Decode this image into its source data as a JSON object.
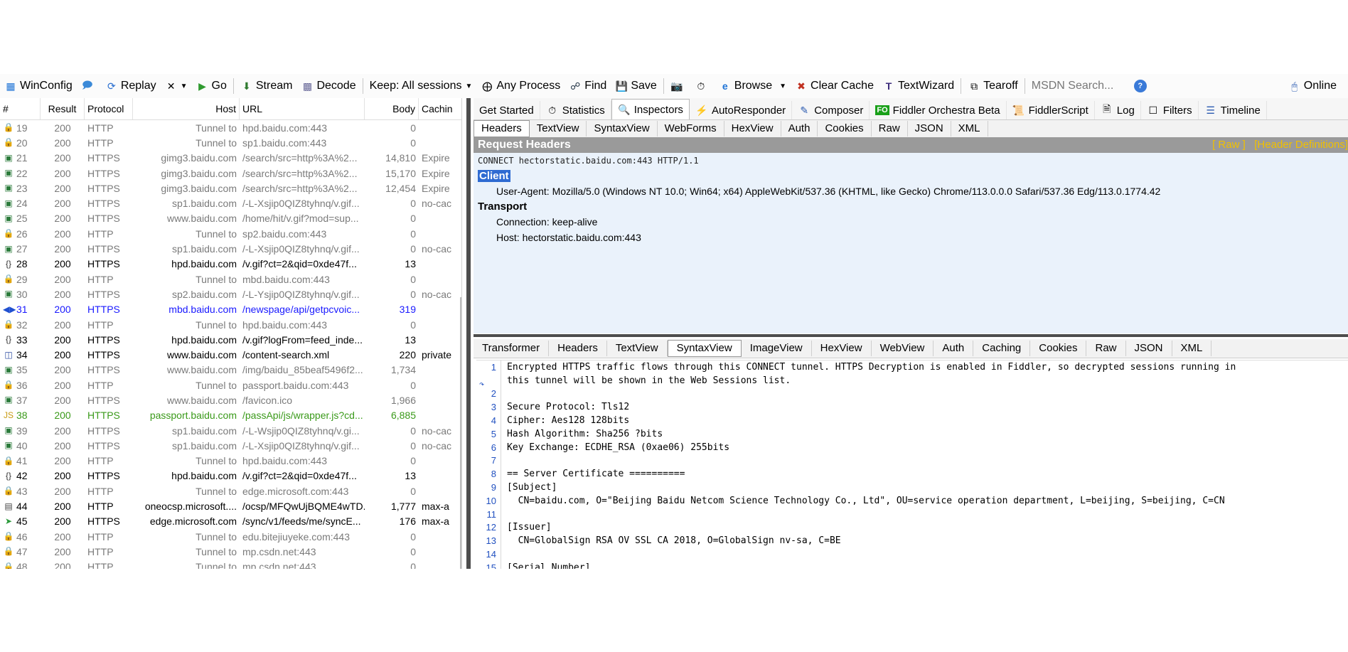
{
  "toolbar": {
    "winconfig": "WinConfig",
    "replay": "Replay",
    "go": "Go",
    "stream": "Stream",
    "decode": "Decode",
    "keep": "Keep: All sessions",
    "any_process": "Any Process",
    "find": "Find",
    "save": "Save",
    "browse": "Browse",
    "clear_cache": "Clear Cache",
    "textwizard": "TextWizard",
    "tearoff": "Tearoff",
    "msdn_search": "MSDN Search...",
    "online": "Online"
  },
  "session_columns": [
    "#",
    "Result",
    "Protocol",
    "Host",
    "URL",
    "Body",
    "Cachin"
  ],
  "sessions": [
    {
      "num": "19",
      "result": "200",
      "protocol": "HTTP",
      "host": "Tunnel to",
      "url": "hpd.baidu.com:443",
      "body": "0",
      "cache": "",
      "style": "tunnel",
      "icon": "lock-icon"
    },
    {
      "num": "20",
      "result": "200",
      "protocol": "HTTP",
      "host": "Tunnel to",
      "url": "sp1.baidu.com:443",
      "body": "0",
      "cache": "",
      "style": "tunnel",
      "icon": "lock-icon"
    },
    {
      "num": "21",
      "result": "200",
      "protocol": "HTTPS",
      "host": "gimg3.baidu.com",
      "url": "/search/src=http%3A%2...",
      "body": "14,810",
      "cache": "Expire",
      "style": "tunnel",
      "icon": "image-icon"
    },
    {
      "num": "22",
      "result": "200",
      "protocol": "HTTPS",
      "host": "gimg3.baidu.com",
      "url": "/search/src=http%3A%2...",
      "body": "15,170",
      "cache": "Expire",
      "style": "tunnel",
      "icon": "image-icon"
    },
    {
      "num": "23",
      "result": "200",
      "protocol": "HTTPS",
      "host": "gimg3.baidu.com",
      "url": "/search/src=http%3A%2...",
      "body": "12,454",
      "cache": "Expire",
      "style": "tunnel",
      "icon": "image-icon"
    },
    {
      "num": "24",
      "result": "200",
      "protocol": "HTTPS",
      "host": "sp1.baidu.com",
      "url": "/-L-Xsjip0QIZ8tyhnq/v.gif...",
      "body": "0",
      "cache": "no-cac",
      "style": "tunnel",
      "icon": "image-icon"
    },
    {
      "num": "25",
      "result": "200",
      "protocol": "HTTPS",
      "host": "www.baidu.com",
      "url": "/home/hit/v.gif?mod=sup...",
      "body": "0",
      "cache": "",
      "style": "tunnel",
      "icon": "image-icon"
    },
    {
      "num": "26",
      "result": "200",
      "protocol": "HTTP",
      "host": "Tunnel to",
      "url": "sp2.baidu.com:443",
      "body": "0",
      "cache": "",
      "style": "tunnel",
      "icon": "lock-icon"
    },
    {
      "num": "27",
      "result": "200",
      "protocol": "HTTPS",
      "host": "sp1.baidu.com",
      "url": "/-L-Xsjip0QIZ8tyhnq/v.gif...",
      "body": "0",
      "cache": "no-cac",
      "style": "tunnel",
      "icon": "image-icon"
    },
    {
      "num": "28",
      "result": "200",
      "protocol": "HTTPS",
      "host": "hpd.baidu.com",
      "url": "/v.gif?ct=2&qid=0xde47f...",
      "body": "13",
      "cache": "",
      "style": "normal",
      "icon": "json-icon"
    },
    {
      "num": "29",
      "result": "200",
      "protocol": "HTTP",
      "host": "Tunnel to",
      "url": "mbd.baidu.com:443",
      "body": "0",
      "cache": "",
      "style": "tunnel",
      "icon": "lock-icon"
    },
    {
      "num": "30",
      "result": "200",
      "protocol": "HTTPS",
      "host": "sp2.baidu.com",
      "url": "/-L-Ysjip0QIZ8tyhnq/v.gif...",
      "body": "0",
      "cache": "no-cac",
      "style": "tunnel",
      "icon": "image-icon"
    },
    {
      "num": "31",
      "result": "200",
      "protocol": "HTTPS",
      "host": "mbd.baidu.com",
      "url": "/newspage/api/getpcvoic...",
      "body": "319",
      "cache": "",
      "style": "blue",
      "icon": "arrows-icon"
    },
    {
      "num": "32",
      "result": "200",
      "protocol": "HTTP",
      "host": "Tunnel to",
      "url": "hpd.baidu.com:443",
      "body": "0",
      "cache": "",
      "style": "tunnel",
      "icon": "lock-icon"
    },
    {
      "num": "33",
      "result": "200",
      "protocol": "HTTPS",
      "host": "hpd.baidu.com",
      "url": "/v.gif?logFrom=feed_inde...",
      "body": "13",
      "cache": "",
      "style": "normal",
      "icon": "json-icon"
    },
    {
      "num": "34",
      "result": "200",
      "protocol": "HTTPS",
      "host": "www.baidu.com",
      "url": "/content-search.xml",
      "body": "220",
      "cache": "private",
      "style": "normal",
      "icon": "xml-icon"
    },
    {
      "num": "35",
      "result": "200",
      "protocol": "HTTPS",
      "host": "www.baidu.com",
      "url": "/img/baidu_85beaf5496f2...",
      "body": "1,734",
      "cache": "",
      "style": "tunnel",
      "icon": "image-icon"
    },
    {
      "num": "36",
      "result": "200",
      "protocol": "HTTP",
      "host": "Tunnel to",
      "url": "passport.baidu.com:443",
      "body": "0",
      "cache": "",
      "style": "tunnel",
      "icon": "lock-icon"
    },
    {
      "num": "37",
      "result": "200",
      "protocol": "HTTPS",
      "host": "www.baidu.com",
      "url": "/favicon.ico",
      "body": "1,966",
      "cache": "",
      "style": "tunnel",
      "icon": "image-icon"
    },
    {
      "num": "38",
      "result": "200",
      "protocol": "HTTPS",
      "host": "passport.baidu.com",
      "url": "/passApi/js/wrapper.js?cd...",
      "body": "6,885",
      "cache": "",
      "style": "green",
      "icon": "js-icon"
    },
    {
      "num": "39",
      "result": "200",
      "protocol": "HTTPS",
      "host": "sp1.baidu.com",
      "url": "/-L-Wsjip0QIZ8tyhnq/v.gi...",
      "body": "0",
      "cache": "no-cac",
      "style": "tunnel",
      "icon": "image-icon"
    },
    {
      "num": "40",
      "result": "200",
      "protocol": "HTTPS",
      "host": "sp1.baidu.com",
      "url": "/-L-Xsjip0QIZ8tyhnq/v.gif...",
      "body": "0",
      "cache": "no-cac",
      "style": "tunnel",
      "icon": "image-icon"
    },
    {
      "num": "41",
      "result": "200",
      "protocol": "HTTP",
      "host": "Tunnel to",
      "url": "hpd.baidu.com:443",
      "body": "0",
      "cache": "",
      "style": "tunnel",
      "icon": "lock-icon"
    },
    {
      "num": "42",
      "result": "200",
      "protocol": "HTTPS",
      "host": "hpd.baidu.com",
      "url": "/v.gif?ct=2&qid=0xde47f...",
      "body": "13",
      "cache": "",
      "style": "normal",
      "icon": "json-icon"
    },
    {
      "num": "43",
      "result": "200",
      "protocol": "HTTP",
      "host": "Tunnel to",
      "url": "edge.microsoft.com:443",
      "body": "0",
      "cache": "",
      "style": "tunnel",
      "icon": "lock-icon"
    },
    {
      "num": "44",
      "result": "200",
      "protocol": "HTTP",
      "host": "oneocsp.microsoft....",
      "url": "/ocsp/MFQwUjBQME4wTD...",
      "body": "1,777",
      "cache": "max-a",
      "style": "normal",
      "icon": "doc-icon"
    },
    {
      "num": "45",
      "result": "200",
      "protocol": "HTTPS",
      "host": "edge.microsoft.com",
      "url": "/sync/v1/feeds/me/syncE...",
      "body": "176",
      "cache": "max-a",
      "style": "normal",
      "icon": "post-icon"
    },
    {
      "num": "46",
      "result": "200",
      "protocol": "HTTP",
      "host": "Tunnel to",
      "url": "edu.bitejiuyeke.com:443",
      "body": "0",
      "cache": "",
      "style": "tunnel",
      "icon": "lock-icon"
    },
    {
      "num": "47",
      "result": "200",
      "protocol": "HTTP",
      "host": "Tunnel to",
      "url": "mp.csdn.net:443",
      "body": "0",
      "cache": "",
      "style": "tunnel",
      "icon": "lock-icon"
    },
    {
      "num": "48",
      "result": "200",
      "protocol": "HTTP",
      "host": "Tunnel to",
      "url": "mp.csdn.net:443",
      "body": "0",
      "cache": "",
      "style": "tunnel",
      "icon": "lock-icon"
    }
  ],
  "main_tabs": [
    "Get Started",
    "Statistics",
    "Inspectors",
    "AutoResponder",
    "Composer",
    "Fiddler Orchestra Beta",
    "FiddlerScript",
    "Log",
    "Filters",
    "Timeline"
  ],
  "fo_badge": "FO",
  "request_tabs": [
    "Headers",
    "TextView",
    "SyntaxView",
    "WebForms",
    "HexView",
    "Auth",
    "Cookies",
    "Raw",
    "JSON",
    "XML"
  ],
  "request": {
    "title": "Request Headers",
    "raw_link": "[ Raw ]",
    "defs_link": "[Header Definitions]",
    "line": "CONNECT hectorstatic.baidu.com:443 HTTP/1.1",
    "client_label": "Client",
    "user_agent": "User-Agent: Mozilla/5.0 (Windows NT 10.0; Win64; x64) AppleWebKit/537.36 (KHTML, like Gecko) Chrome/113.0.0.0 Safari/537.36 Edg/113.0.1774.42",
    "transport_label": "Transport",
    "connection": "Connection: keep-alive",
    "host": "Host: hectorstatic.baidu.com:443"
  },
  "response_tabs": [
    "Transformer",
    "Headers",
    "TextView",
    "SyntaxView",
    "ImageView",
    "HexView",
    "WebView",
    "Auth",
    "Caching",
    "Cookies",
    "Raw",
    "JSON",
    "XML"
  ],
  "response_lines": [
    {
      "n": "1",
      "t": "Encrypted HTTPS traffic flows through this CONNECT tunnel. HTTPS Decryption is enabled in Fiddler, so decrypted sessions running in"
    },
    {
      "n": "",
      "t": "this tunnel will be shown in the Web Sessions list."
    },
    {
      "n": "2",
      "t": ""
    },
    {
      "n": "3",
      "t": "Secure Protocol: Tls12"
    },
    {
      "n": "4",
      "t": "Cipher: Aes128 128bits"
    },
    {
      "n": "5",
      "t": "Hash Algorithm: Sha256 ?bits"
    },
    {
      "n": "6",
      "t": "Key Exchange: ECDHE_RSA (0xae06) 255bits"
    },
    {
      "n": "7",
      "t": ""
    },
    {
      "n": "8",
      "t": "== Server Certificate =========="
    },
    {
      "n": "9",
      "t": "[Subject]"
    },
    {
      "n": "10",
      "t": "  CN=baidu.com, O=\"Beijing Baidu Netcom Science Technology Co., Ltd\", OU=service operation department, L=beijing, S=beijing, C=CN"
    },
    {
      "n": "11",
      "t": ""
    },
    {
      "n": "12",
      "t": "[Issuer]"
    },
    {
      "n": "13",
      "t": "  CN=GlobalSign RSA OV SSL CA 2018, O=GlobalSign nv-sa, C=BE"
    },
    {
      "n": "14",
      "t": ""
    },
    {
      "n": "15",
      "t": "[Serial Number]"
    }
  ],
  "colors": {
    "tunnel_text": "#7a7a7a",
    "blue_row": "#1a1aff",
    "green_row": "#3a9a1a",
    "accent": "#2f6bd2",
    "header_bar": "#9a9a9a",
    "raw_links": "#f0c000"
  }
}
